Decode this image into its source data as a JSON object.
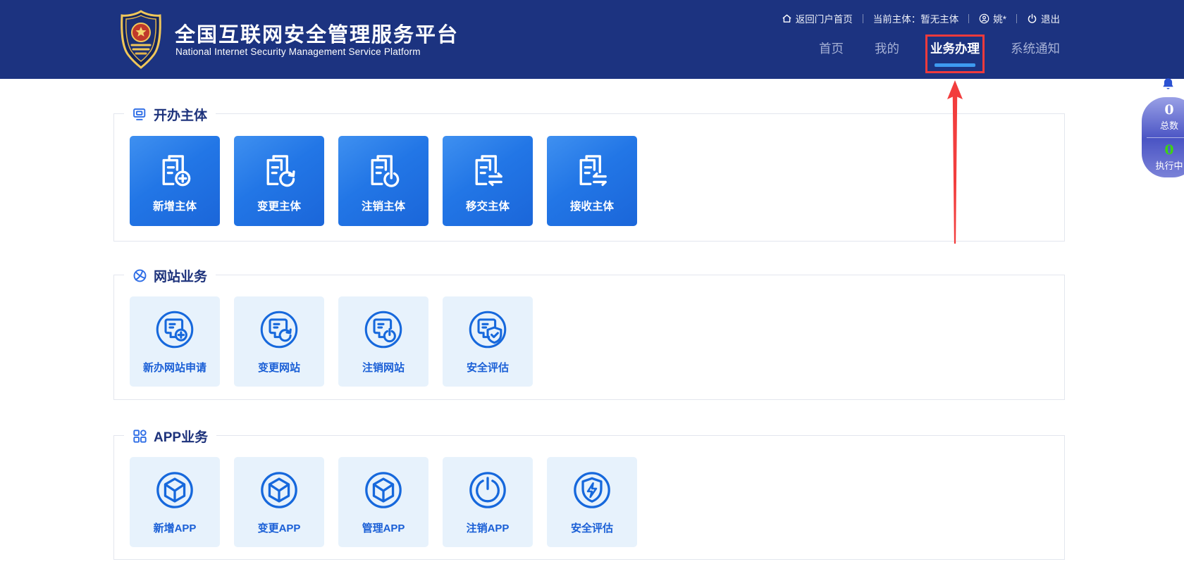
{
  "brand": {
    "title_cn": "全国互联网安全管理服务平台",
    "title_en": "National Internet Security Management Service Platform"
  },
  "utility": {
    "home": "返回门户首页",
    "current_subject": "当前主体：暂无主体",
    "user": "姚*",
    "logout": "退出"
  },
  "nav": {
    "items": [
      {
        "label": "首页",
        "active": false
      },
      {
        "label": "我的",
        "active": false
      },
      {
        "label": "业务办理",
        "active": true,
        "annotated": true
      },
      {
        "label": "系统通知",
        "active": false
      }
    ]
  },
  "sections": [
    {
      "title": "开办主体",
      "icon": "monitor-icon",
      "style": "solid",
      "items": [
        {
          "label": "新增主体",
          "icon": "doc-add-icon"
        },
        {
          "label": "变更主体",
          "icon": "doc-refresh-icon"
        },
        {
          "label": "注销主体",
          "icon": "doc-power-icon"
        },
        {
          "label": "移交主体",
          "icon": "doc-transfer-icon"
        },
        {
          "label": "接收主体",
          "icon": "doc-receive-icon"
        }
      ]
    },
    {
      "title": "网站业务",
      "icon": "globe-icon",
      "style": "light",
      "items": [
        {
          "label": "新办网站申请",
          "icon": "site-add-icon"
        },
        {
          "label": "变更网站",
          "icon": "site-refresh-icon"
        },
        {
          "label": "注销网站",
          "icon": "site-power-icon"
        },
        {
          "label": "安全评估",
          "icon": "site-shield-check-icon"
        }
      ]
    },
    {
      "title": "APP业务",
      "icon": "grid-icon",
      "style": "light",
      "items": [
        {
          "label": "新增APP",
          "icon": "cube-icon"
        },
        {
          "label": "变更APP",
          "icon": "cube-icon"
        },
        {
          "label": "管理APP",
          "icon": "cube-icon"
        },
        {
          "label": "注销APP",
          "icon": "power-circle-icon"
        },
        {
          "label": "安全评估",
          "icon": "shield-bolt-icon"
        }
      ]
    }
  ],
  "task_widget": {
    "total_value": "0",
    "total_label": "总数",
    "running_value": "0",
    "running_label": "执行中"
  },
  "colors": {
    "header_bg": "#1c3380",
    "accent_blue": "#1668dc",
    "active_underline": "#3d9af0",
    "annotation_red": "#ee3a3c",
    "solid_button_gradient_start": "#3f90f0",
    "solid_button_gradient_end": "#1b66d9",
    "light_button_bg": "#e7f2fc",
    "running_green": "#3ed313"
  }
}
